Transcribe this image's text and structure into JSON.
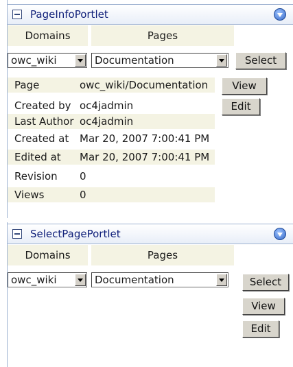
{
  "page_info_portlet": {
    "title": "PageInfoPortlet",
    "columns": {
      "domains": "Domains",
      "pages": "Pages"
    },
    "domain_select": {
      "value": "owc_wiki"
    },
    "page_select": {
      "value": "Documentation"
    },
    "select_button": "Select",
    "view_button": "View",
    "edit_button": "Edit",
    "rows": [
      {
        "label": "Page",
        "value": "owc_wiki/Documentation"
      },
      {
        "label": "Created by",
        "value": "oc4jadmin"
      },
      {
        "label": "Last Author",
        "value": "oc4jadmin"
      },
      {
        "label": "Created at",
        "value": "Mar 20, 2007 7:00:41 PM"
      },
      {
        "label": "Edited at",
        "value": "Mar 20, 2007 7:00:41 PM"
      },
      {
        "label": "Revision",
        "value": "0"
      },
      {
        "label": "Views",
        "value": "0"
      }
    ]
  },
  "select_page_portlet": {
    "title": "SelectPagePortlet",
    "columns": {
      "domains": "Domains",
      "pages": "Pages"
    },
    "domain_select": {
      "value": "owc_wiki"
    },
    "page_select": {
      "value": "Documentation"
    },
    "select_button": "Select",
    "view_button": "View",
    "edit_button": "Edit"
  },
  "colors": {
    "header_border": "#9fb3d1",
    "title_text": "#10207a",
    "row_shade": "#f4f3e3",
    "button_face": "#d8d5cc"
  }
}
